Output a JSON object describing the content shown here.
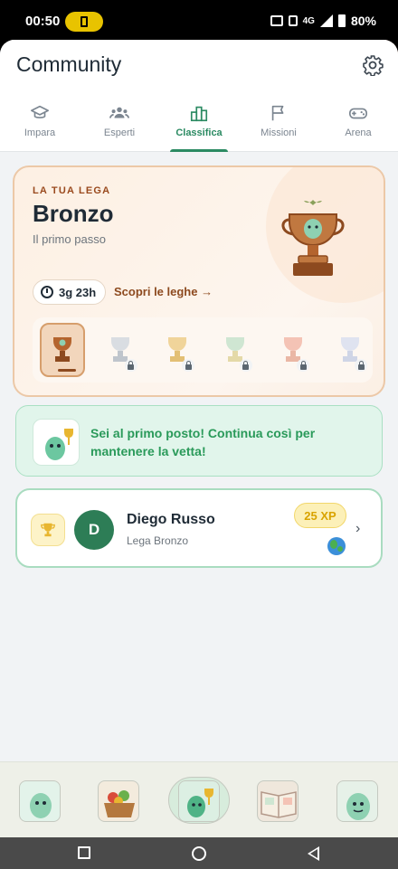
{
  "status_bar": {
    "time": "00:50",
    "network": "4G",
    "battery": "80%"
  },
  "header": {
    "title": "Community"
  },
  "tabs": [
    {
      "label": "Impara",
      "icon": "graduation-cap-icon",
      "active": false
    },
    {
      "label": "Esperti",
      "icon": "people-icon",
      "active": false
    },
    {
      "label": "Classifica",
      "icon": "podium-icon",
      "active": true
    },
    {
      "label": "Missioni",
      "icon": "flag-icon",
      "active": false
    },
    {
      "label": "Arena",
      "icon": "gamepad-icon",
      "active": false
    }
  ],
  "league": {
    "kicker": "LA TUA LEGA",
    "name": "Bronzo",
    "subtitle": "Il primo passo",
    "timer": "3g 23h",
    "link": "Scopri le leghe",
    "tiers": [
      {
        "icon": "bronze-trophy-icon",
        "locked": false,
        "current": true
      },
      {
        "icon": "silver-trophy-icon",
        "locked": true
      },
      {
        "icon": "gold-trophy-icon",
        "locked": true
      },
      {
        "icon": "emerald-trophy-icon",
        "locked": true
      },
      {
        "icon": "ruby-trophy-icon",
        "locked": true
      },
      {
        "icon": "diamond-trophy-icon",
        "locked": true
      }
    ]
  },
  "banner": {
    "text": "Sei al primo posto! Continua così per mantenere la vetta!"
  },
  "ranking": {
    "avatar_initial": "D",
    "name": "Diego Russo",
    "league": "Lega Bronzo",
    "xp": "25 XP"
  },
  "bottom_nav": [
    {
      "icon": "mascot-icon",
      "active": false
    },
    {
      "icon": "food-basket-icon",
      "active": false
    },
    {
      "icon": "trophy-mascot-icon",
      "active": true
    },
    {
      "icon": "book-icon",
      "active": false
    },
    {
      "icon": "mascot-profile-icon",
      "active": false
    }
  ],
  "colors": {
    "accent": "#2b8a62",
    "bronze": "#b4642e",
    "banner_green": "#2a9a5a",
    "xp_gold": "#d9a300"
  }
}
